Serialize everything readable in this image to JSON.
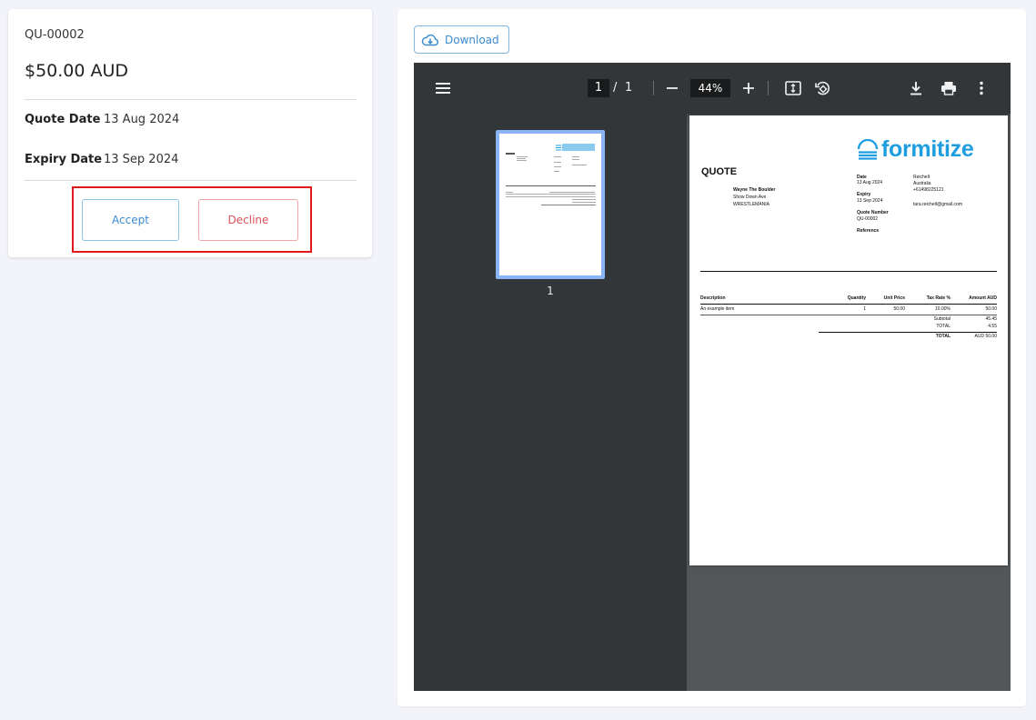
{
  "quote": {
    "number": "QU-00002",
    "amount": "$50.00 AUD",
    "quote_date_label": "Quote Date",
    "quote_date": "13 Aug 2024",
    "expiry_date_label": "Expiry Date",
    "expiry_date": "13 Sep 2024",
    "accept_label": "Accept",
    "decline_label": "Decline"
  },
  "viewer": {
    "download_label": "Download",
    "page_current": "1",
    "page_separator": "/",
    "page_total": "1",
    "zoom": "44%",
    "thumbnail_label": "1"
  },
  "document": {
    "brand": "formitize",
    "title": "QUOTE",
    "customer_name": "Wayne The Boulder",
    "customer_address1": "Show Down Ave",
    "customer_address2": "WRESTLEMANIA",
    "date_label": "Date",
    "date_value": "13 Aug 2024",
    "expiry_label": "Expiry",
    "expiry_value": "13 Sep 2024",
    "quote_number_label": "Quote Number",
    "quote_number_value": "QU-00002",
    "reference_label": "Reference",
    "company_name": "Reichelt",
    "company_country": "Australia",
    "company_phone": "+61498225121",
    "company_email": "tara.reichelt@gmail.com",
    "columns": [
      "Description",
      "Quantity",
      "Unit Price",
      "Tax Rate %",
      "Amount AUD"
    ],
    "items": [
      {
        "description": "An example item",
        "quantity": "1",
        "unit_price": "50.00",
        "tax_rate": "10.00%",
        "amount": "50.00"
      }
    ],
    "subtotal_label": "Subtotal",
    "subtotal_value": "45.45",
    "tax_total_label": "TOTAL",
    "tax_total_value": "4.55",
    "total_label": "TOTAL",
    "total_value": "AUD 50.00"
  },
  "colors": {
    "accent": "#3b8bd1",
    "decline": "#e05159",
    "highlight": "#e0181a",
    "brand": "#1e9ee0",
    "viewer_toolbar": "#323639"
  },
  "icons": {
    "download": "cloud-download-icon",
    "menu": "hamburger-menu-icon",
    "zoom_out": "minus-icon",
    "zoom_in": "plus-icon",
    "fit": "fit-to-page-icon",
    "rotate": "rotate-icon",
    "save": "download-icon",
    "print": "print-icon",
    "more": "more-vertical-icon"
  }
}
